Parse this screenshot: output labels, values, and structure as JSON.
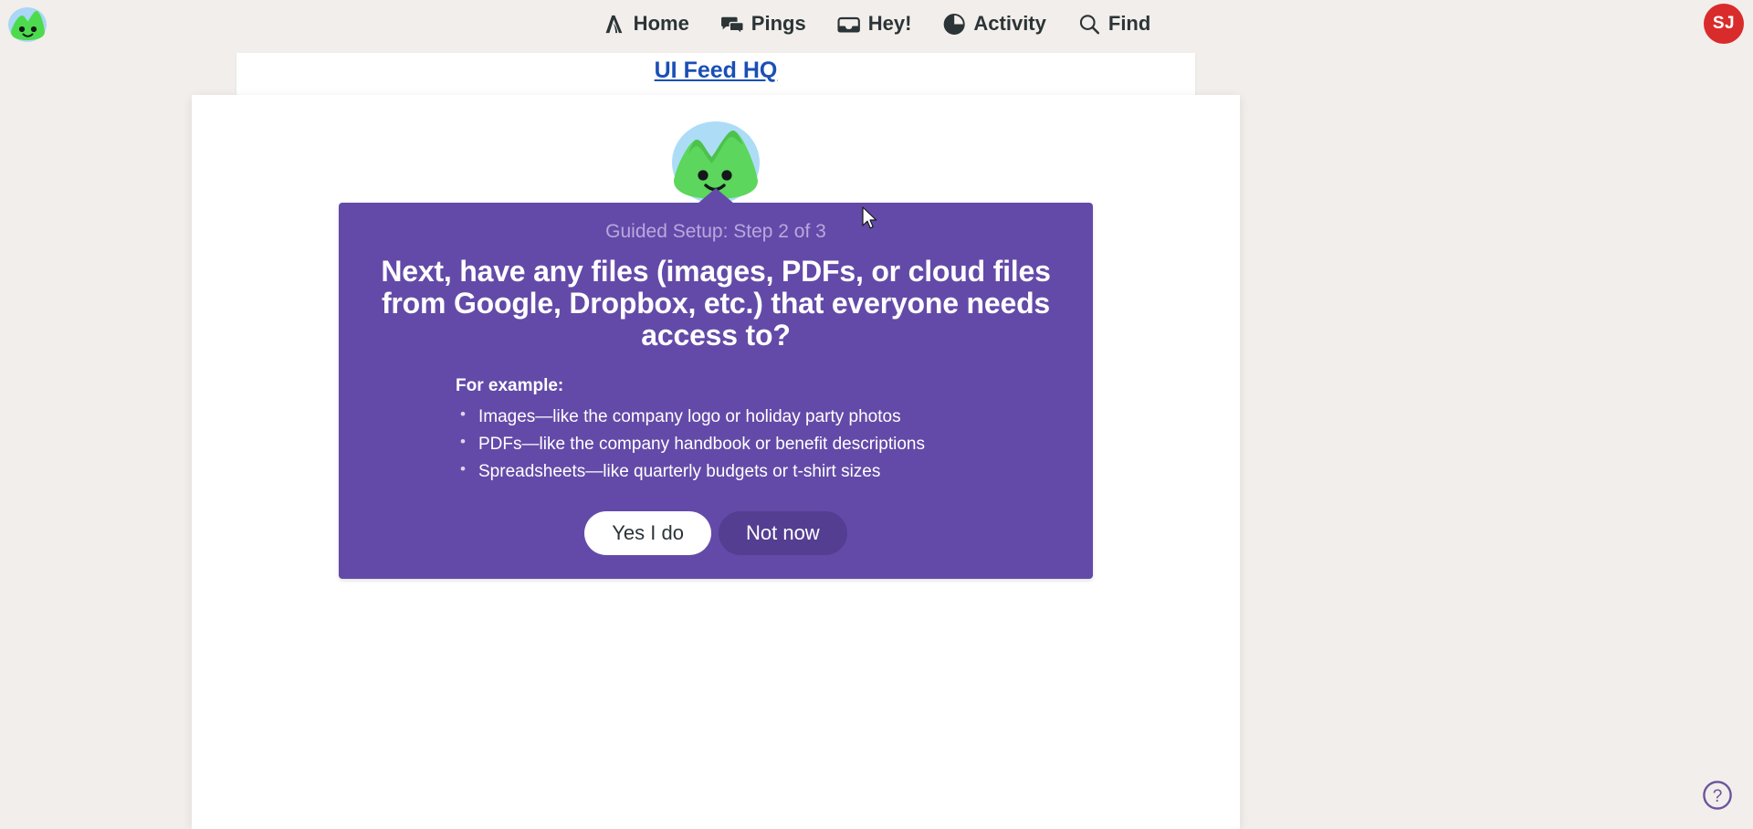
{
  "app": {
    "background_color": "#f2eeeb",
    "accent_purple": "#634aa8",
    "link_blue": "#1a4fb5",
    "avatar_color": "#d92b2b"
  },
  "topnav": {
    "logo_name": "basecamp-mascot-logo",
    "items": [
      {
        "label": "Home",
        "icon": "home-icon"
      },
      {
        "label": "Pings",
        "icon": "chat-bubbles-icon"
      },
      {
        "label": "Hey!",
        "icon": "inbox-tray-icon"
      },
      {
        "label": "Activity",
        "icon": "pie-clock-icon"
      },
      {
        "label": "Find",
        "icon": "search-icon"
      }
    ],
    "avatar_initials": "SJ"
  },
  "page": {
    "title": "UI Feed HQ"
  },
  "callout": {
    "mascot_icon": "green-mountain-mascot",
    "step_label": "Guided Setup: Step 2 of 3",
    "headline": "Next, have any files (images, PDFs, or cloud files from Google, Dropbox, etc.) that everyone needs access to?",
    "examples_title": "For example:",
    "examples": [
      "Images—like the company logo or holiday party photos",
      "PDFs—like the company handbook or benefit descriptions",
      "Spreadsheets—like quarterly budgets or t-shirt sizes"
    ],
    "primary_button": "Yes I do",
    "secondary_button": "Not now"
  },
  "help": {
    "icon": "question-mark-circle-icon",
    "label": "?"
  }
}
